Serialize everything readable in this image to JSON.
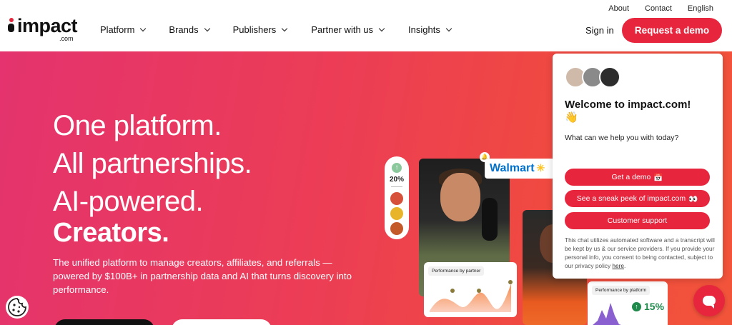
{
  "utility_nav": [
    "About",
    "Contact",
    "English"
  ],
  "brand": {
    "name": "impact",
    "suffix": ".com"
  },
  "nav": [
    "Platform",
    "Brands",
    "Publishers",
    "Partner with us",
    "Insights"
  ],
  "header": {
    "signin": "Sign in",
    "demo": "Request a demo"
  },
  "hero": {
    "lines": [
      "One platform.",
      "All partnerships.",
      "AI-powered."
    ],
    "highlight": "Creators.",
    "subtitle": "The unified platform to manage creators, affiliates, and referrals — powered by $100B+ in partnership data and AI that turns discovery into performance."
  },
  "collage": {
    "pill_pct": "20%",
    "brand_badge": "Walmart",
    "card1_label": "Performance by partner",
    "card2_label": "Performance by platform",
    "stat": "15%"
  },
  "chat": {
    "title": "Welcome to impact.com!",
    "emoji": "👋",
    "question": "What can we help you with today?",
    "options": [
      "Get a demo",
      "See a sneak peek of impact.com",
      "Customer support"
    ],
    "option_emojis": [
      "📅",
      "👀"
    ],
    "disclaimer": "This chat utilizes automated software and a transcript will be kept by us & our service providers. If you provide your personal info, you consent to being contacted, subject to our privacy policy",
    "disclaimer_link": "here"
  },
  "colors": {
    "accent": "#e7263e",
    "hero_start": "#e4336e",
    "hero_end": "#f2543a"
  }
}
